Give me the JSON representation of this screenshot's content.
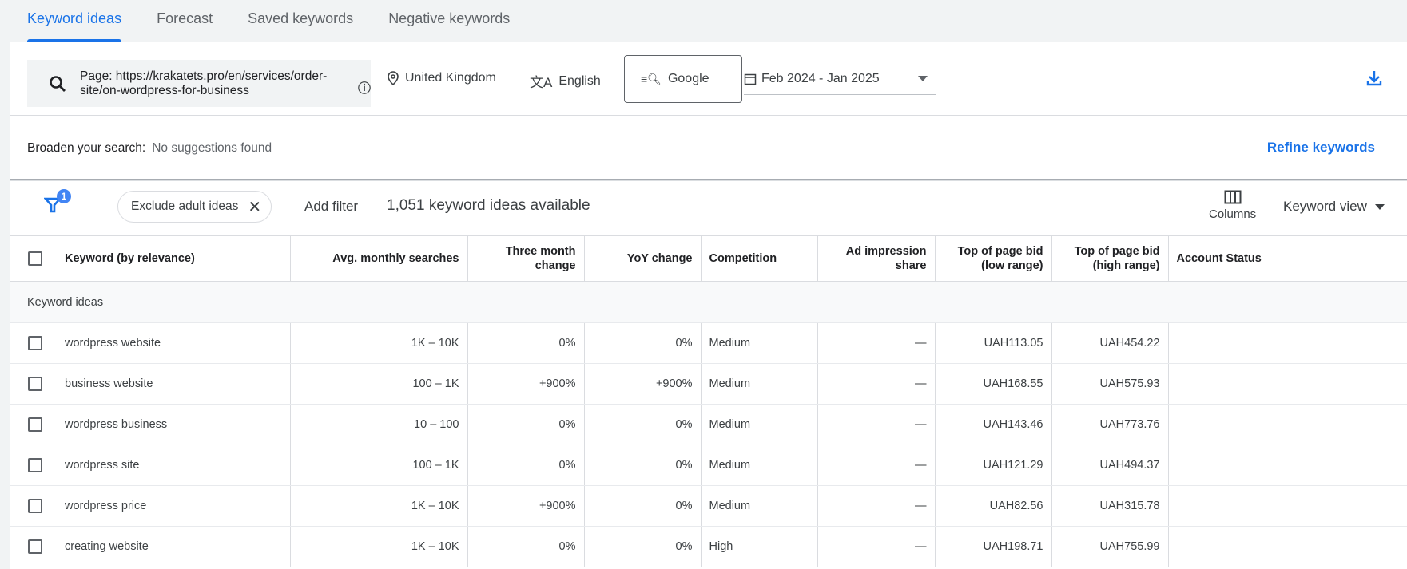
{
  "tabs": [
    "Keyword ideas",
    "Forecast",
    "Saved keywords",
    "Negative keywords"
  ],
  "search": {
    "value": "Page: https://krakatets.pro/en/services/order-site/on-wordpress-for-business",
    "location": "United Kingdom",
    "language": "English",
    "network": "Google",
    "date_range": "Feb 2024 - Jan 2025"
  },
  "broaden": {
    "label": "Broaden your search:",
    "value": "No suggestions found",
    "refine": "Refine keywords"
  },
  "filters": {
    "badge": "1",
    "chip": "Exclude adult ideas",
    "add": "Add filter",
    "count": "1,051 keyword ideas available",
    "columns": "Columns",
    "view": "Keyword view"
  },
  "table": {
    "headers": [
      "Keyword (by relevance)",
      "Avg. monthly searches",
      "Three month change",
      "YoY change",
      "Competition",
      "Ad impression share",
      "Top of page bid (low range)",
      "Top of page bid (high range)",
      "Account Status"
    ],
    "section": "Keyword ideas",
    "rows": [
      [
        "wordpress website",
        "1K – 10K",
        "0%",
        "0%",
        "Medium",
        "—",
        "UAH113.05",
        "UAH454.22",
        ""
      ],
      [
        "business website",
        "100 – 1K",
        "+900%",
        "+900%",
        "Medium",
        "—",
        "UAH168.55",
        "UAH575.93",
        ""
      ],
      [
        "wordpress business",
        "10 – 100",
        "0%",
        "0%",
        "Medium",
        "—",
        "UAH143.46",
        "UAH773.76",
        ""
      ],
      [
        "wordpress site",
        "100 – 1K",
        "0%",
        "0%",
        "Medium",
        "—",
        "UAH121.29",
        "UAH494.37",
        ""
      ],
      [
        "wordpress price",
        "1K – 10K",
        "+900%",
        "0%",
        "Medium",
        "—",
        "UAH82.56",
        "UAH315.78",
        ""
      ],
      [
        "creating website",
        "1K – 10K",
        "0%",
        "0%",
        "High",
        "—",
        "UAH198.71",
        "UAH755.99",
        ""
      ]
    ]
  },
  "colors": {
    "accent": "#1a73e8",
    "badge": "#4285f4"
  }
}
